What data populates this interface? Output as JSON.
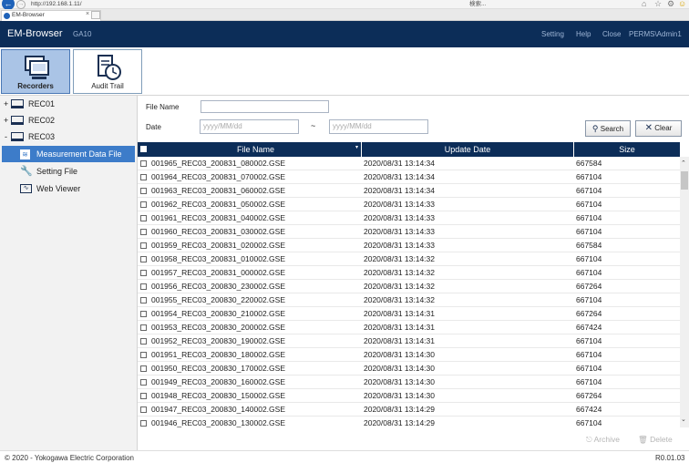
{
  "browser": {
    "url": "http://192.168.1.11/",
    "search_placeholder": "検索...",
    "tab_title": "EM-Browser"
  },
  "header": {
    "app_title": "EM-Browser",
    "device": "GA10",
    "nav": [
      "Setting",
      "Help",
      "Close",
      "PERMS\\Admin1"
    ]
  },
  "toolbar": {
    "recorders_label": "Recorders",
    "audit_label": "Audit Trail"
  },
  "sidebar": {
    "recorders": [
      {
        "toggle": "+",
        "label": "REC01"
      },
      {
        "toggle": "+",
        "label": "REC02"
      },
      {
        "toggle": "-",
        "label": "REC03"
      }
    ],
    "items": [
      {
        "label": "Measurement Data File",
        "icon": "chart-file-icon",
        "selected": true
      },
      {
        "label": "Setting File",
        "icon": "wrench-icon",
        "selected": false
      },
      {
        "label": "Web Viewer",
        "icon": "waveform-icon",
        "selected": false
      }
    ]
  },
  "filter": {
    "file_name_label": "File Name",
    "file_name_value": "",
    "date_label": "Date",
    "date_from_placeholder": "yyyy/MM/dd",
    "date_separator": "~",
    "date_to_placeholder": "yyyy/MM/dd",
    "search_label": "Search",
    "clear_label": "Clear"
  },
  "table": {
    "columns": [
      "File Name",
      "Update Date",
      "Size"
    ],
    "rows": [
      [
        "001965_REC03_200831_080002.GSE",
        "2020/08/31 13:14:34",
        "667584"
      ],
      [
        "001964_REC03_200831_070002.GSE",
        "2020/08/31 13:14:34",
        "667104"
      ],
      [
        "001963_REC03_200831_060002.GSE",
        "2020/08/31 13:14:34",
        "667104"
      ],
      [
        "001962_REC03_200831_050002.GSE",
        "2020/08/31 13:14:33",
        "667104"
      ],
      [
        "001961_REC03_200831_040002.GSE",
        "2020/08/31 13:14:33",
        "667104"
      ],
      [
        "001960_REC03_200831_030002.GSE",
        "2020/08/31 13:14:33",
        "667104"
      ],
      [
        "001959_REC03_200831_020002.GSE",
        "2020/08/31 13:14:33",
        "667584"
      ],
      [
        "001958_REC03_200831_010002.GSE",
        "2020/08/31 13:14:32",
        "667104"
      ],
      [
        "001957_REC03_200831_000002.GSE",
        "2020/08/31 13:14:32",
        "667104"
      ],
      [
        "001956_REC03_200830_230002.GSE",
        "2020/08/31 13:14:32",
        "667264"
      ],
      [
        "001955_REC03_200830_220002.GSE",
        "2020/08/31 13:14:32",
        "667104"
      ],
      [
        "001954_REC03_200830_210002.GSE",
        "2020/08/31 13:14:31",
        "667264"
      ],
      [
        "001953_REC03_200830_200002.GSE",
        "2020/08/31 13:14:31",
        "667424"
      ],
      [
        "001952_REC03_200830_190002.GSE",
        "2020/08/31 13:14:31",
        "667104"
      ],
      [
        "001951_REC03_200830_180002.GSE",
        "2020/08/31 13:14:30",
        "667104"
      ],
      [
        "001950_REC03_200830_170002.GSE",
        "2020/08/31 13:14:30",
        "667104"
      ],
      [
        "001949_REC03_200830_160002.GSE",
        "2020/08/31 13:14:30",
        "667104"
      ],
      [
        "001948_REC03_200830_150002.GSE",
        "2020/08/31 13:14:30",
        "667264"
      ],
      [
        "001947_REC03_200830_140002.GSE",
        "2020/08/31 13:14:29",
        "667424"
      ],
      [
        "001946_REC03_200830_130002.GSE",
        "2020/08/31 13:14:29",
        "667104"
      ]
    ]
  },
  "actions": {
    "archive_label": "Archive",
    "delete_label": "Delete"
  },
  "status": {
    "copyright": "© 2020 - Yokogawa Electric Corporation",
    "version": "R0.01.03"
  },
  "colors": {
    "header_bg": "#0c2d58",
    "selected_item": "#3d7cc9",
    "toolbar_active": "#aac4e6"
  }
}
